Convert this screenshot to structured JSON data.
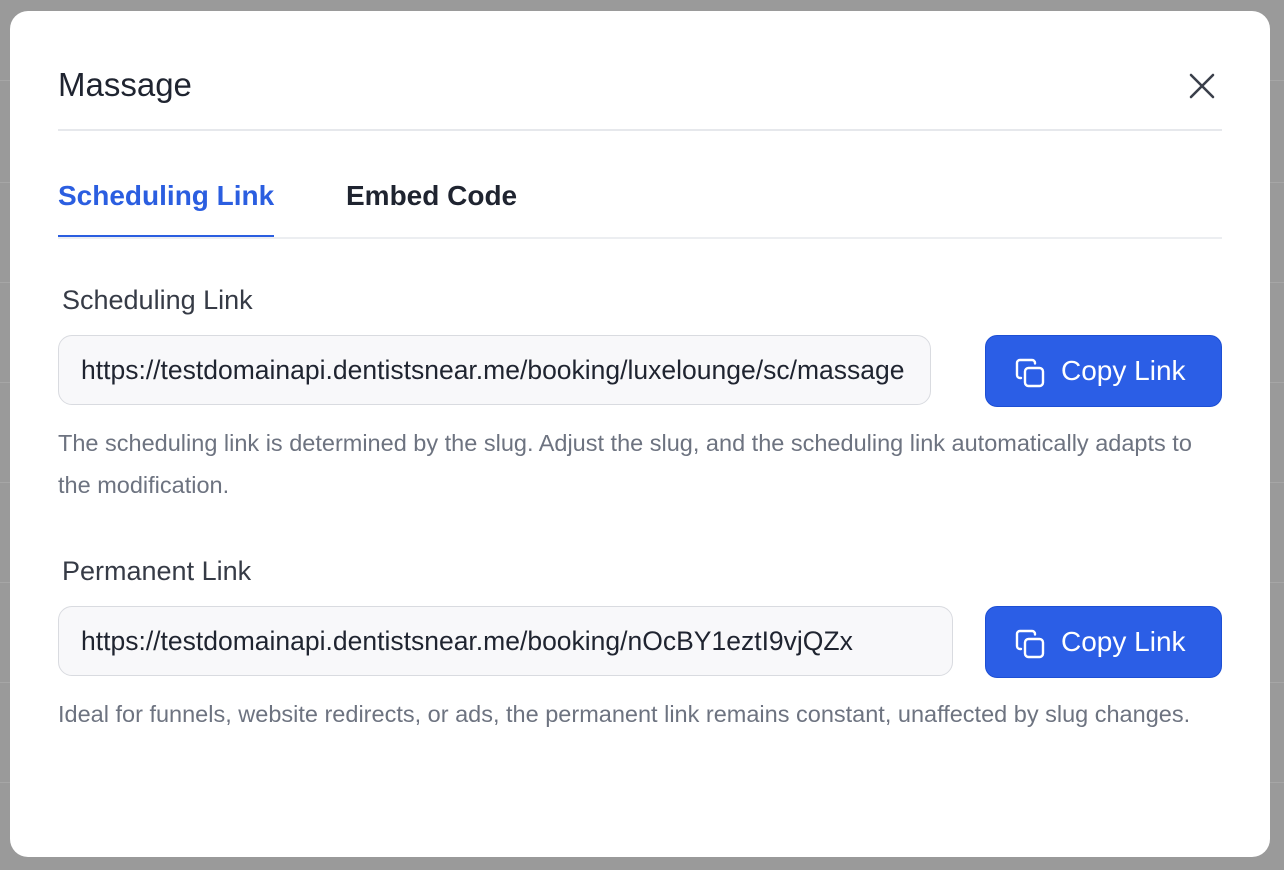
{
  "modal": {
    "title": "Massage"
  },
  "tabs": [
    {
      "label": "Scheduling Link",
      "active": true
    },
    {
      "label": "Embed Code",
      "active": false
    }
  ],
  "scheduling": {
    "label": "Scheduling Link",
    "value": "https://testdomainapi.dentistsnear.me/booking/luxelounge/sc/massage",
    "button_label": "Copy Link",
    "help": "The scheduling link is determined by the slug. Adjust the slug, and the scheduling link automatically adapts to the modification."
  },
  "permanent": {
    "label": "Permanent Link",
    "value": "https://testdomainapi.dentistsnear.me/booking/nOcBY1eztI9vjQZx",
    "button_label": "Copy Link",
    "help": "Ideal for funnels, website redirects, or ads, the permanent link remains constant, unaffected by slug changes."
  },
  "colors": {
    "accent": "#2b5ee6",
    "backdrop": "#9a9a9a"
  },
  "icons": {
    "close": "close-icon",
    "copy": "copy-icon"
  }
}
